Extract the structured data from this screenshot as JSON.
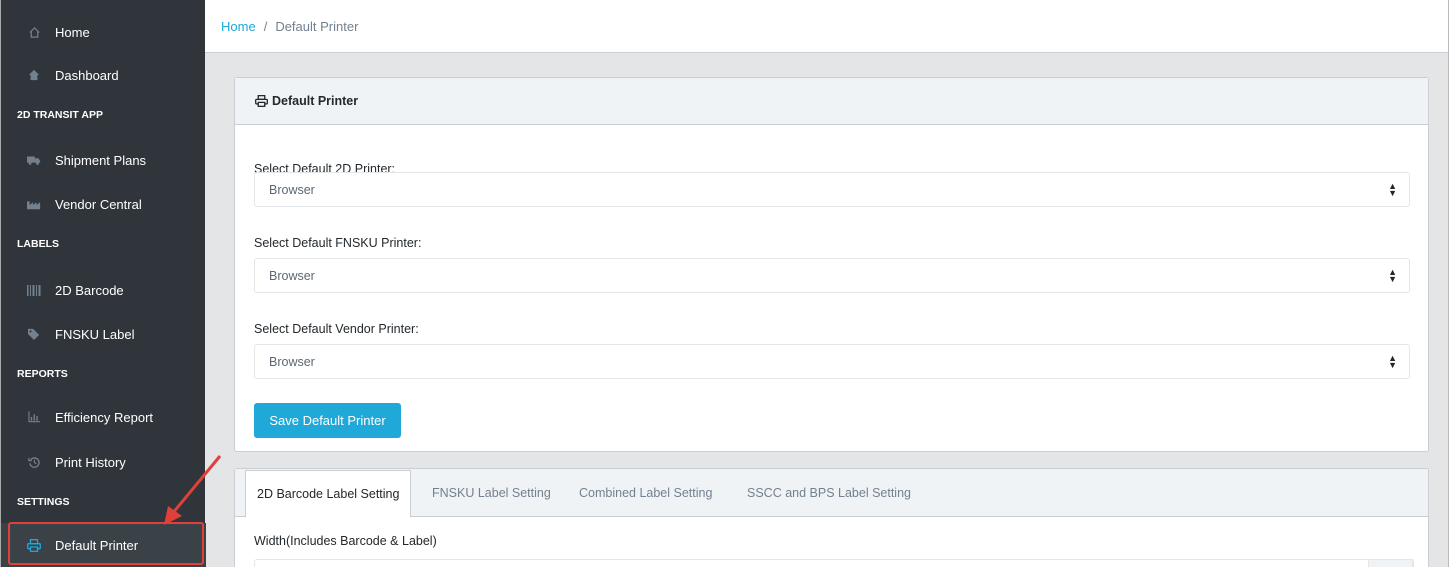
{
  "sidebar": {
    "home": "Home",
    "dashboard": "Dashboard",
    "section_transit": "2D TRANSIT APP",
    "shipment_plans": "Shipment Plans",
    "vendor_central": "Vendor Central",
    "section_labels": "LABELS",
    "barcode_2d": "2D Barcode",
    "fnsku_label": "FNSKU Label",
    "section_reports": "REPORTS",
    "efficiency_report": "Efficiency Report",
    "print_history": "Print History",
    "section_settings": "SETTINGS",
    "default_printer": "Default Printer"
  },
  "breadcrumb": {
    "home": "Home",
    "separator": "/",
    "current": "Default Printer"
  },
  "printer_card": {
    "title": "Default Printer",
    "label_2d": "Select Default 2D Printer:",
    "value_2d": "Browser",
    "label_fnsku": "Select Default FNSKU Printer:",
    "value_fnsku": "Browser",
    "label_vendor": "Select Default Vendor Printer:",
    "value_vendor": "Browser",
    "save_button": "Save Default Printer"
  },
  "label_settings": {
    "tabs": [
      "2D Barcode Label Setting",
      "FNSKU Label Setting",
      "Combined Label Setting",
      "SSCC and BPS Label Setting"
    ],
    "active_tab": "2D Barcode Label Setting",
    "width_label": "Width(Includes Barcode & Label)"
  },
  "colors": {
    "sidebar_bg": "#2f353a",
    "accent": "#20a8d8",
    "highlight": "#e0403a"
  }
}
